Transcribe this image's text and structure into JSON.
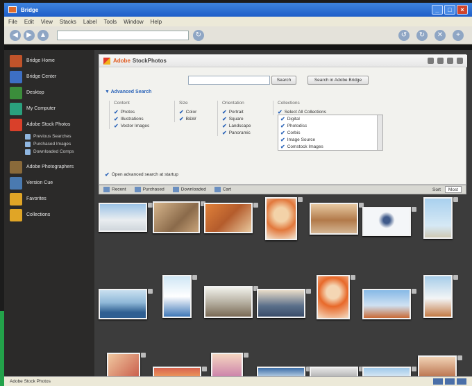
{
  "window": {
    "title": "Bridge",
    "menu": [
      "File",
      "Edit",
      "View",
      "Stacks",
      "Label",
      "Tools",
      "Window",
      "Help"
    ],
    "address": "",
    "buttons": {
      "minimize": "_",
      "maximize": "□",
      "close": "×"
    }
  },
  "sidebar": {
    "items": [
      {
        "label": "Bridge Home",
        "icon": "bridge-home-icon",
        "color": "#c0532a"
      },
      {
        "label": "Bridge Center",
        "icon": "bridge-center-icon",
        "color": "#3d6fc4"
      },
      {
        "label": "Desktop",
        "icon": "desktop-icon",
        "color": "#3b8d3b"
      },
      {
        "label": "My Computer",
        "icon": "computer-icon",
        "color": "#2aa07d"
      },
      {
        "label": "Adobe Stock Photos",
        "icon": "stock-photos-icon",
        "color": "#d9402a"
      }
    ],
    "subitems": [
      "Previous Searches",
      "Purchased Images",
      "Downloaded Comps"
    ],
    "items2": [
      {
        "label": "Adobe Photographers",
        "icon": "camera-icon",
        "color": "#8a6a3a"
      },
      {
        "label": "Version Cue",
        "icon": "version-cue-icon",
        "color": "#4a7ab0"
      },
      {
        "label": "Favorites",
        "icon": "folder-icon",
        "color": "#e0a526"
      },
      {
        "label": "Collections",
        "icon": "folder-icon",
        "color": "#e0a526"
      }
    ]
  },
  "stock": {
    "brand_adobe": "Adobe",
    "brand_name": "StockPhotos",
    "search_placeholder": "",
    "search_button": "Search",
    "search_link": "Search in Adobe Bridge",
    "advanced_label": "Advanced Search",
    "groups": [
      {
        "title": "Content",
        "options": [
          "Photos",
          "Illustrations",
          "Vector Images"
        ]
      },
      {
        "title": "Size",
        "options": [
          "Color",
          "B&W"
        ]
      },
      {
        "title": "Orientation",
        "options": [
          "Portrait",
          "Square",
          "Landscape",
          "Panoramic"
        ]
      }
    ],
    "collections_title": "Collections",
    "collections_top": "Select All Collections",
    "collections": [
      "Digital",
      "Photodisc",
      "Corbis",
      "Image Source",
      "Comstock Images"
    ],
    "open_advanced": "Open advanced search at startup",
    "footer_items": [
      "Recent",
      "Purchased",
      "Downloaded",
      "Cart"
    ],
    "footer_sort_label": "Sort",
    "footer_sort_value": "Most"
  },
  "status": {
    "text": "Adobe Stock Photos"
  }
}
